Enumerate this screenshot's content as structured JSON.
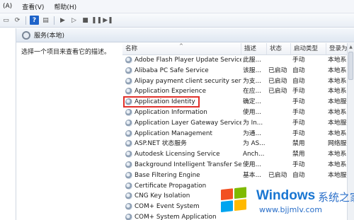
{
  "menu": {
    "items": [
      "(A)",
      "查看(V)",
      "帮助(H)"
    ]
  },
  "pane": {
    "title": "服务(本地)",
    "description": "选择一个项目来查看它的描述。"
  },
  "columns": {
    "name": "名称",
    "desc": "描述",
    "status": "状态",
    "startup": "启动类型",
    "logon": "登录为"
  },
  "services": [
    {
      "name": "Adobe Flash Player Update Service",
      "desc": "此服...",
      "status": "",
      "startup": "手动",
      "logon": "本地系"
    },
    {
      "name": "Alibaba PC Safe Service",
      "desc": "该服...",
      "status": "已启动",
      "startup": "自动",
      "logon": "本地系"
    },
    {
      "name": "Alipay payment client security servi...",
      "desc": "为支...",
      "status": "已启动",
      "startup": "自动",
      "logon": "本地系"
    },
    {
      "name": "Application Experience",
      "desc": "在应...",
      "status": "已启动",
      "startup": "手动",
      "logon": "本地系"
    },
    {
      "name": "Application Identity",
      "desc": "确定...",
      "status": "",
      "startup": "手动",
      "logon": "本地服"
    },
    {
      "name": "Application Information",
      "desc": "使用...",
      "status": "",
      "startup": "手动",
      "logon": "本地系"
    },
    {
      "name": "Application Layer Gateway Service",
      "desc": "为 In...",
      "status": "",
      "startup": "手动",
      "logon": "本地服"
    },
    {
      "name": "Application Management",
      "desc": "为通...",
      "status": "",
      "startup": "手动",
      "logon": "本地系"
    },
    {
      "name": "ASP.NET 状态服务",
      "desc": "为 AS...",
      "status": "",
      "startup": "禁用",
      "logon": "网络服"
    },
    {
      "name": "Autodesk Licensing Service",
      "desc": "Anch...",
      "status": "",
      "startup": "禁用",
      "logon": "本地系"
    },
    {
      "name": "Background Intelligent Transfer Se...",
      "desc": "使用...",
      "status": "",
      "startup": "手动",
      "logon": "本地系"
    },
    {
      "name": "Base Filtering Engine",
      "desc": "基本...",
      "status": "已启动",
      "startup": "自动",
      "logon": "本地服"
    },
    {
      "name": "Certificate Propagation",
      "desc": "",
      "status": "",
      "startup": "",
      "logon": ""
    },
    {
      "name": "CNG Key Isolation",
      "desc": "",
      "status": "",
      "startup": "",
      "logon": ""
    },
    {
      "name": "COM+ Event System",
      "desc": "",
      "status": "",
      "startup": "",
      "logon": ""
    },
    {
      "name": "COM+ System Application",
      "desc": "",
      "status": "",
      "startup": "",
      "logon": ""
    }
  ],
  "watermark": {
    "brand": "Windows",
    "subtitle": "系统之家",
    "url": "www.bjjmlv.com"
  }
}
